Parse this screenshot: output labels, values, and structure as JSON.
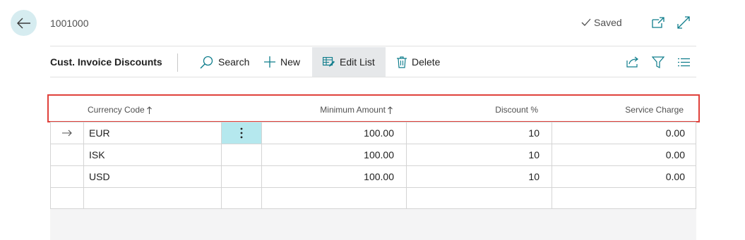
{
  "header": {
    "record_number": "1001000",
    "saved_label": "Saved"
  },
  "toolbar": {
    "caption": "Cust. Invoice Discounts",
    "search_label": "Search",
    "new_label": "New",
    "edit_list_label": "Edit List",
    "delete_label": "Delete"
  },
  "columns": {
    "currency_code": "Currency Code",
    "minimum_amount": "Minimum Amount",
    "discount_pct": "Discount %",
    "service_charge": "Service Charge"
  },
  "rows": [
    {
      "currency_code": "EUR",
      "minimum_amount": "100.00",
      "discount_pct": "10",
      "service_charge": "0.00"
    },
    {
      "currency_code": "ISK",
      "minimum_amount": "100.00",
      "discount_pct": "10",
      "service_charge": "0.00"
    },
    {
      "currency_code": "USD",
      "minimum_amount": "100.00",
      "discount_pct": "10",
      "service_charge": "0.00"
    }
  ],
  "colors": {
    "accent": "#0f7d8c",
    "highlight_border": "#e0413b",
    "selected_cell": "#b5e8ee"
  }
}
